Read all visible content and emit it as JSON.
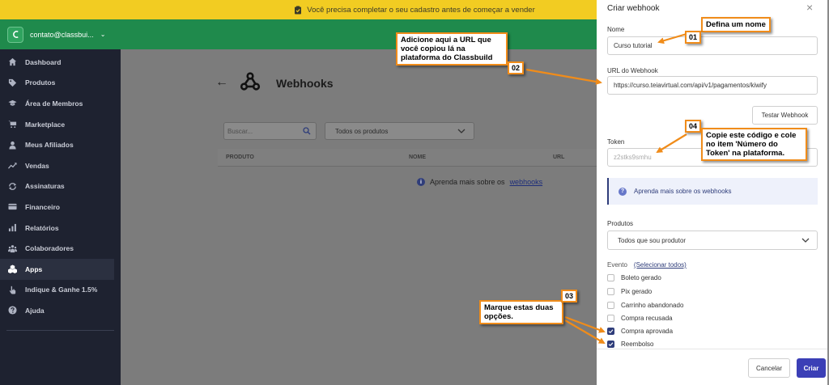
{
  "banner": {
    "text": "Você precisa completar o seu cadastro antes de começar a vender"
  },
  "account": {
    "email": "contato@classbui..."
  },
  "sidebar": {
    "items": [
      {
        "label": "Dashboard",
        "icon": "home-icon"
      },
      {
        "label": "Produtos",
        "icon": "tag-icon"
      },
      {
        "label": "Área de Membros",
        "icon": "graduation-cap-icon"
      },
      {
        "label": "Marketplace",
        "icon": "cart-icon"
      },
      {
        "label": "Meus Afiliados",
        "icon": "user-icon"
      },
      {
        "label": "Vendas",
        "icon": "trend-icon"
      },
      {
        "label": "Assinaturas",
        "icon": "refresh-icon"
      },
      {
        "label": "Financeiro",
        "icon": "wallet-icon"
      },
      {
        "label": "Relatórios",
        "icon": "bar-chart-icon"
      },
      {
        "label": "Colaboradores",
        "icon": "users-icon"
      },
      {
        "label": "Apps",
        "icon": "cubes-icon",
        "active": true
      },
      {
        "label": "Indique & Ganhe 1.5%",
        "icon": "hand-pointer-icon"
      },
      {
        "label": "Ajuda",
        "icon": "help-icon"
      }
    ]
  },
  "main": {
    "title": "Webhooks",
    "search_placeholder": "Buscar...",
    "product_filter": "Todos os produtos",
    "table_headers": [
      "PRODUTO",
      "NOME",
      "URL"
    ],
    "learn_more_prefix": "Aprenda mais sobre os",
    "learn_more_link": "webhooks"
  },
  "drawer": {
    "title": "Criar webhook",
    "name_label": "Nome",
    "name_value": "Curso tutorial",
    "url_label": "URL do Webhook",
    "url_value": "https://curso.teiavirtual.com/api/v1/pagamentos/kiwify",
    "test_button": "Testar Webhook",
    "token_label": "Token",
    "token_value": "z2stks9smhu",
    "info_text": "Aprenda mais sobre os webhooks",
    "products_label": "Produtos",
    "products_value": "Todos que sou produtor",
    "event_label": "Evento",
    "select_all": "(Selecionar todos)",
    "events": [
      {
        "label": "Boleto gerado",
        "checked": false
      },
      {
        "label": "Pix gerado",
        "checked": false
      },
      {
        "label": "Carrinho abandonado",
        "checked": false
      },
      {
        "label": "Compra recusada",
        "checked": false
      },
      {
        "label": "Compra aprovada",
        "checked": true
      },
      {
        "label": "Reembolso",
        "checked": true
      }
    ],
    "cancel_button": "Cancelar",
    "create_button": "Criar"
  },
  "annotations": {
    "c1": {
      "num": "01",
      "text": "Defina um nome"
    },
    "c2": {
      "num": "02",
      "text": "Adicione aqui a URL que você copiou lá na plataforma do Classbuild"
    },
    "c3": {
      "num": "03",
      "text": "Marque estas duas opções."
    },
    "c4": {
      "num": "04",
      "text": "Copie este código e cole no item 'Número do Token' na plataforma."
    }
  },
  "colors": {
    "banner": "#f2cc22",
    "brand_green": "#1f8a4c",
    "sidebar": "#1e2230",
    "primary": "#3b3fb6",
    "callout_border": "#f08c1a"
  }
}
